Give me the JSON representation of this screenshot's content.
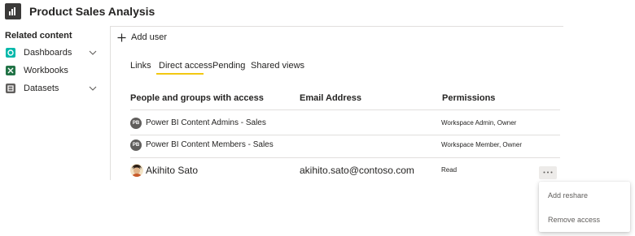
{
  "header": {
    "title": "Product Sales Analysis",
    "icon": "report-chart-icon"
  },
  "sidebar": {
    "heading": "Related content",
    "items": [
      {
        "label": "Dashboards",
        "icon": "dashboard-icon",
        "color": "#01b8aa",
        "expandable": true
      },
      {
        "label": "Workbooks",
        "icon": "excel-workbook-icon",
        "color": "#217346",
        "expandable": false
      },
      {
        "label": "Datasets",
        "icon": "dataset-icon",
        "color": "#605e5c",
        "expandable": true
      }
    ]
  },
  "toolbar": {
    "add_user_label": "Add user"
  },
  "tabs": [
    {
      "label": "Links",
      "active": false
    },
    {
      "label": "Direct access",
      "active": true
    },
    {
      "label": "Pending",
      "active": false
    },
    {
      "label": "Shared views",
      "active": false
    }
  ],
  "table": {
    "columns": [
      "People and groups with access",
      "Email Address",
      "Permissions"
    ],
    "rows": [
      {
        "initials": "PB",
        "name": "Power BI Content Admins - Sales",
        "email": "",
        "permission": "Workspace Admin, Owner"
      },
      {
        "initials": "PB",
        "name": "Power BI Content Members - Sales",
        "email": "",
        "permission": "Workspace Member, Owner"
      },
      {
        "initials": "",
        "name": "Akihito Sato",
        "email": "akihito.sato@contoso.com",
        "permission": "Read"
      }
    ]
  },
  "more_options": {
    "label": "...",
    "menu": [
      "Add reshare",
      "Remove access"
    ]
  },
  "colors": {
    "accent": "#f2c811",
    "divider": "#e1dfdd",
    "text": "#252423"
  }
}
